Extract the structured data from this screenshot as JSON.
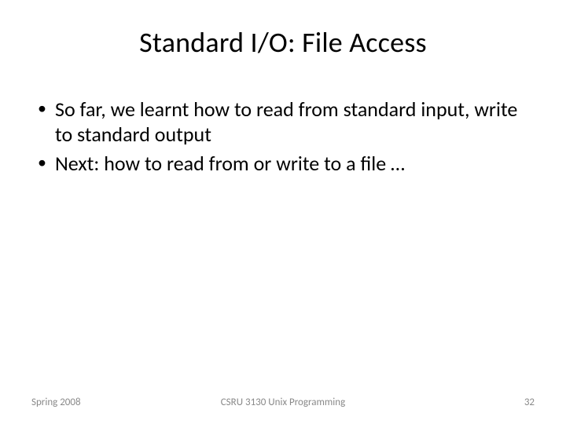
{
  "slide": {
    "title": "Standard I/O: File Access",
    "bullets": [
      "So far, we learnt how to read from standard input, write to standard output",
      "Next: how to read from or write to a file …"
    ],
    "footer": {
      "left": "Spring 2008",
      "center": "CSRU 3130 Unix Programming",
      "page": "32"
    }
  }
}
